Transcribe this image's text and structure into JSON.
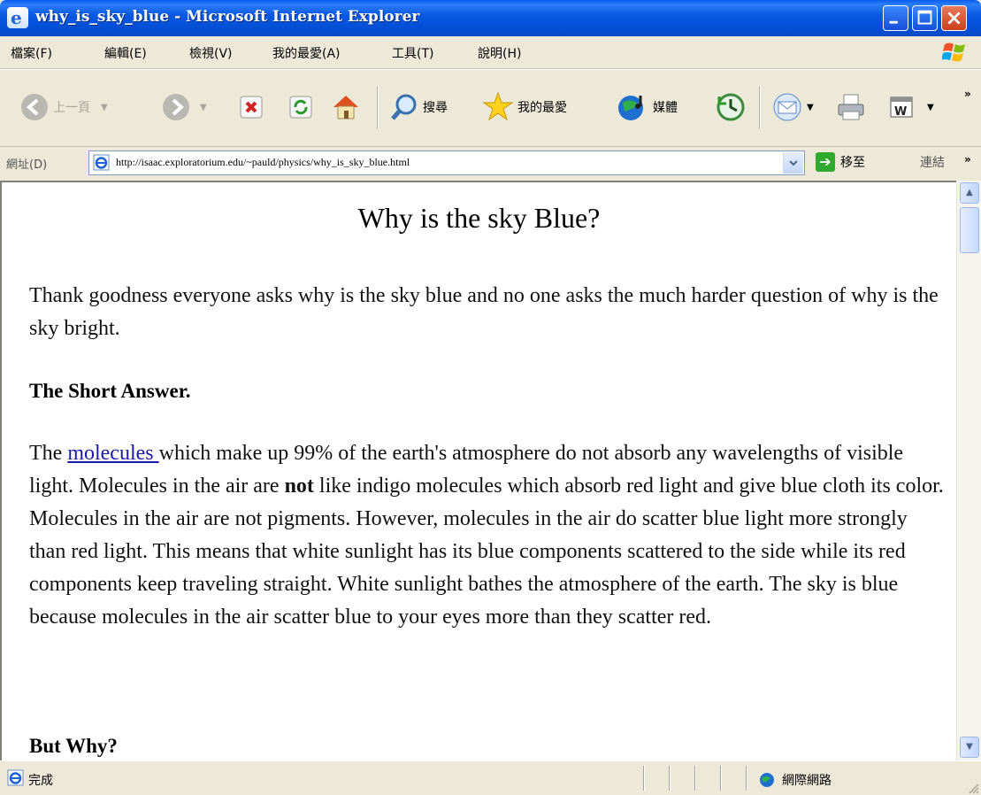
{
  "window": {
    "title": "why_is_sky_blue - Microsoft Internet Explorer"
  },
  "menu": {
    "items": [
      "檔案(F)",
      "編輯(E)",
      "檢視(V)",
      "我的最愛(A)",
      "工具(T)",
      "說明(H)"
    ]
  },
  "toolbar": {
    "back_label": "上一頁",
    "search_label": "搜尋",
    "favorites_label": "我的最愛",
    "media_label": "媒體"
  },
  "address": {
    "label": "網址(D)",
    "url": "http://isaac.exploratorium.edu/~pauld/physics/why_is_sky_blue.html",
    "go_label": "移至",
    "links_label": "連結"
  },
  "page": {
    "title": "Why is the sky Blue?",
    "intro": "Thank goodness everyone asks why is the sky blue and no one asks the much harder question of why is the sky bright.",
    "short_answer_heading": "The Short Answer.",
    "short_answer_lead": "The ",
    "short_answer_link": "molecules ",
    "short_answer_mid1": "which make up 99% of the earth's atmosphere do not absorb any wavelengths of visible light. Molecules in the air are ",
    "short_answer_bold": "not",
    "short_answer_rest": " like indigo molecules which absorb red light and give blue cloth its color. Molecules in the air are not pigments. However, molecules in the air do scatter blue light more strongly than red light. This means that white sunlight has its blue components scattered to the side while its red components keep traveling straight. White sunlight bathes the atmosphere of the earth. The sky is blue because molecules in the air scatter blue to your eyes more than they scatter red.",
    "but_why_heading": "But Why?"
  },
  "status": {
    "text": "完成",
    "zone": "網際網路"
  },
  "colors": {
    "titlebar": "#0a5cf0",
    "link": "#1a1aa6",
    "chrome": "#ece9d8"
  }
}
